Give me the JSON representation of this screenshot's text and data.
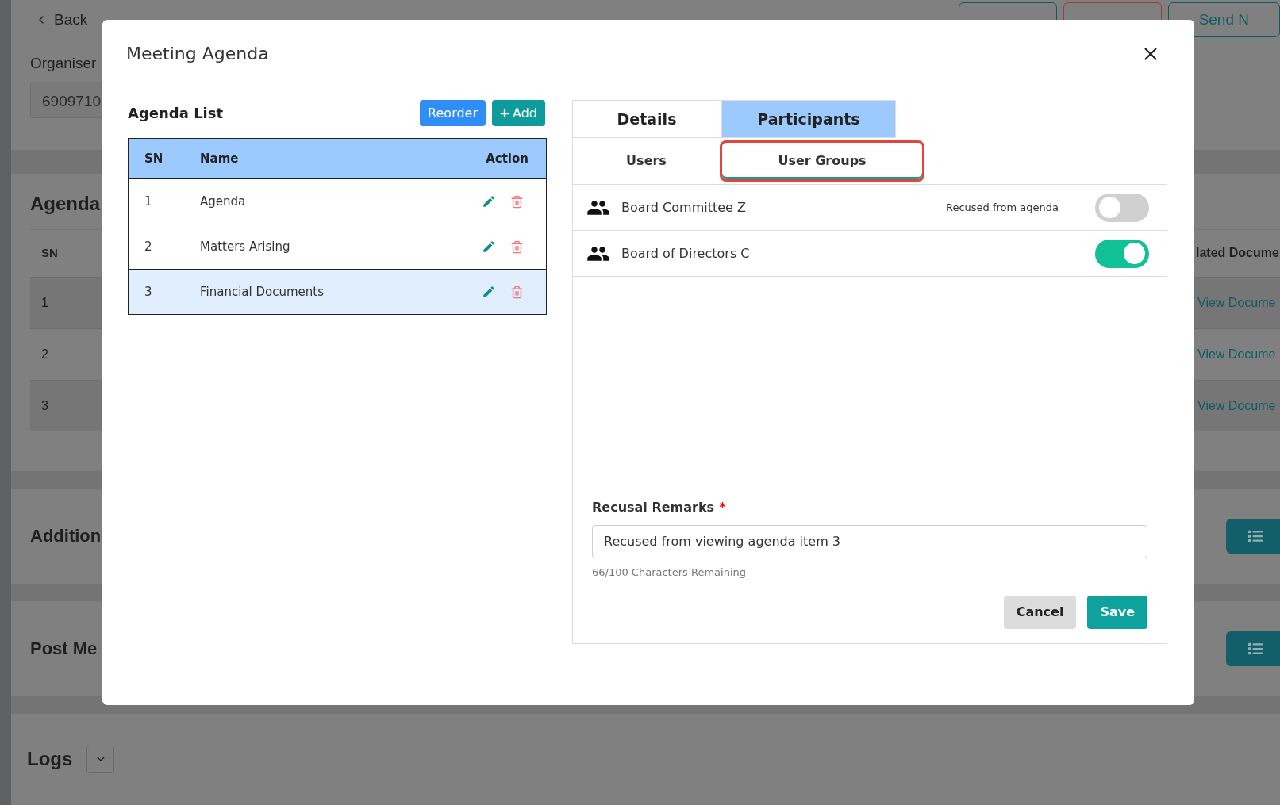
{
  "page": {
    "back": "Back",
    "actions": [
      {
        "kind": "outline"
      },
      {
        "kind": "danger"
      },
      {
        "label": "Send N",
        "kind": "outline"
      }
    ],
    "organiser": {
      "label": "Organiser",
      "value": "6909710"
    },
    "agenda": {
      "title": "Agenda",
      "columns": [
        "SN",
        "lated Docume"
      ],
      "rows": [
        {
          "sn": "1",
          "link": "View Docume"
        },
        {
          "sn": "2",
          "link": "View Docume"
        },
        {
          "sn": "3",
          "link": "View Docume"
        }
      ]
    },
    "sections": [
      {
        "title": "Addition"
      },
      {
        "title": "Post Me"
      }
    ],
    "logs": {
      "title": "Logs"
    }
  },
  "modal": {
    "title": "Meeting Agenda",
    "agenda_list": {
      "title": "Agenda List",
      "buttons": [
        {
          "label": "Reorder",
          "kind": "reorder"
        },
        {
          "label": "Add",
          "kind": "add"
        }
      ],
      "columns": [
        "SN",
        "Name",
        "Action"
      ],
      "rows": [
        {
          "sn": "1",
          "name": "Agenda",
          "selected": false
        },
        {
          "sn": "2",
          "name": "Matters Arising",
          "selected": false
        },
        {
          "sn": "3",
          "name": "Financial Documents",
          "selected": true
        }
      ]
    },
    "tabs": [
      {
        "label": "Details",
        "selected": false
      },
      {
        "label": "Participants",
        "selected": true
      }
    ],
    "subtabs": [
      {
        "label": "Users",
        "selected": false,
        "outlined": false
      },
      {
        "label": "User Groups",
        "selected": true,
        "outlined": true
      }
    ],
    "groups": [
      {
        "name": "Board Committee Z",
        "note": "Recused from agenda",
        "on": false
      },
      {
        "name": "Board of Directors C",
        "on": true
      }
    ],
    "remarks": {
      "label": "Recusal Remarks",
      "required_mark": "*",
      "value": "Recused from viewing agenda item 3",
      "counter": "66/100 Characters Remaining"
    },
    "buttons": [
      {
        "label": "Cancel",
        "kind": "secondary"
      },
      {
        "label": "Save",
        "kind": "primary"
      }
    ]
  }
}
